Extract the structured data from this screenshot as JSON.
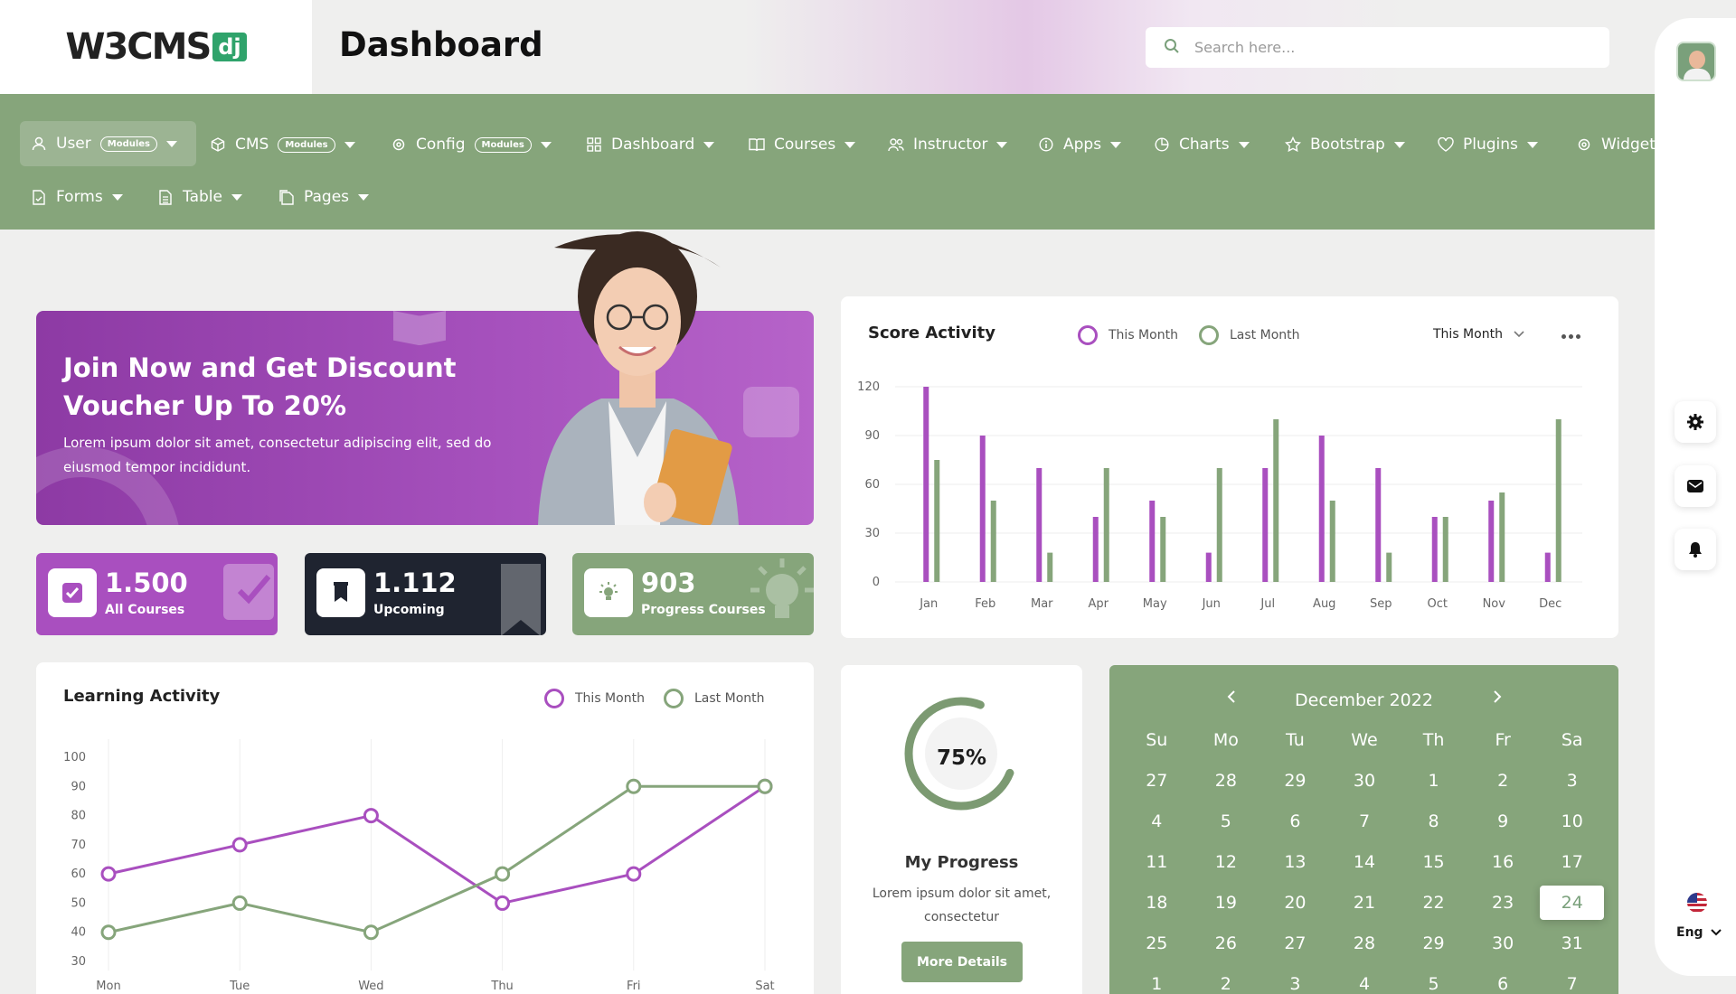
{
  "header": {
    "logo_text": "W3CMS",
    "logo_suffix": "dj",
    "title": "Dashboard",
    "search_placeholder": "Search here..."
  },
  "nav": {
    "items": [
      {
        "label": "User",
        "pill": "Modules",
        "icon": "user-icon"
      },
      {
        "label": "CMS",
        "pill": "Modules",
        "icon": "box-icon"
      },
      {
        "label": "Config",
        "pill": "Modules",
        "icon": "gear-icon"
      },
      {
        "label": "Dashboard",
        "icon": "grid-icon"
      },
      {
        "label": "Courses",
        "icon": "book-open-icon"
      },
      {
        "label": "Instructor",
        "icon": "users-icon"
      },
      {
        "label": "Apps",
        "icon": "info-icon"
      },
      {
        "label": "Charts",
        "icon": "pie-chart-icon"
      },
      {
        "label": "Bootstrap",
        "icon": "star-icon"
      },
      {
        "label": "Plugins",
        "icon": "heart-icon"
      },
      {
        "label": "Widget",
        "icon": "gear-icon"
      },
      {
        "label": "Forms",
        "icon": "file-check-icon"
      },
      {
        "label": "Table",
        "icon": "file-table-icon"
      },
      {
        "label": "Pages",
        "icon": "files-icon"
      }
    ]
  },
  "banner": {
    "title": "Join Now and Get Discount Voucher Up To 20%",
    "text": "Lorem ipsum dolor sit amet, consectetur adipiscing elit, sed do eiusmod tempor incididunt."
  },
  "stats": [
    {
      "value": "1.500",
      "label": "All Courses",
      "color": "#a94fbf",
      "icon": "check-square-icon"
    },
    {
      "value": "1.112",
      "label": "Upcoming",
      "color": "#1f2430",
      "icon": "bookmark-icon"
    },
    {
      "value": "903",
      "label": "Progress Courses",
      "color": "#86a57b",
      "icon": "lightbulb-icon"
    }
  ],
  "score_activity": {
    "title": "Score Activity",
    "legend_this": "This Month",
    "legend_last": "Last Month",
    "dropdown": "This Month"
  },
  "learning_activity": {
    "title": "Learning Activity",
    "legend_this": "This Month",
    "legend_last": "Last Month"
  },
  "progress": {
    "percent_label": "75%",
    "value": 0.75,
    "title": "My Progress",
    "text": "Lorem ipsum dolor sit amet, consectetur",
    "button": "More Details"
  },
  "calendar": {
    "month": "December 2022",
    "days_of_week": [
      "Su",
      "Mo",
      "Tu",
      "We",
      "Th",
      "Fr",
      "Sa"
    ],
    "dates": [
      "27",
      "28",
      "29",
      "30",
      "1",
      "2",
      "3",
      "4",
      "5",
      "6",
      "7",
      "8",
      "9",
      "10",
      "11",
      "12",
      "13",
      "14",
      "15",
      "16",
      "17",
      "18",
      "19",
      "20",
      "21",
      "22",
      "23",
      "24",
      "25",
      "26",
      "27",
      "28",
      "29",
      "30",
      "31",
      "1",
      "2",
      "3",
      "4",
      "5",
      "6",
      "7"
    ],
    "selected": "24"
  },
  "rail": {
    "language": "Eng"
  },
  "colors": {
    "purple": "#a94fbf",
    "green": "#86a57b",
    "dark": "#1f2430"
  },
  "chart_data": [
    {
      "type": "bar",
      "title": "Score Activity",
      "categories": [
        "Jan",
        "Feb",
        "Mar",
        "Apr",
        "May",
        "Jun",
        "Jul",
        "Aug",
        "Sep",
        "Oct",
        "Nov",
        "Dec"
      ],
      "ylim": [
        0,
        120
      ],
      "yticks": [
        0,
        30,
        60,
        90,
        120
      ],
      "series": [
        {
          "name": "This Month",
          "color": "#a94fbf",
          "values": [
            120,
            90,
            70,
            40,
            50,
            18,
            70,
            90,
            70,
            40,
            50,
            18
          ]
        },
        {
          "name": "Last Month",
          "color": "#86a57b",
          "values": [
            75,
            50,
            18,
            70,
            40,
            70,
            100,
            50,
            18,
            40,
            55,
            100
          ]
        }
      ],
      "legend": "top"
    },
    {
      "type": "line",
      "title": "Learning Activity",
      "categories": [
        "Mon",
        "Tue",
        "Wed",
        "Thu",
        "Fri",
        "Sat"
      ],
      "ylim": [
        30,
        100
      ],
      "yticks": [
        30,
        40,
        50,
        60,
        70,
        80,
        90,
        100
      ],
      "series": [
        {
          "name": "This Month",
          "color": "#a94fbf",
          "values": [
            60,
            70,
            80,
            50,
            60,
            90
          ]
        },
        {
          "name": "Last Month",
          "color": "#86a57b",
          "values": [
            40,
            50,
            40,
            60,
            90,
            90
          ]
        }
      ],
      "legend": "top"
    }
  ]
}
